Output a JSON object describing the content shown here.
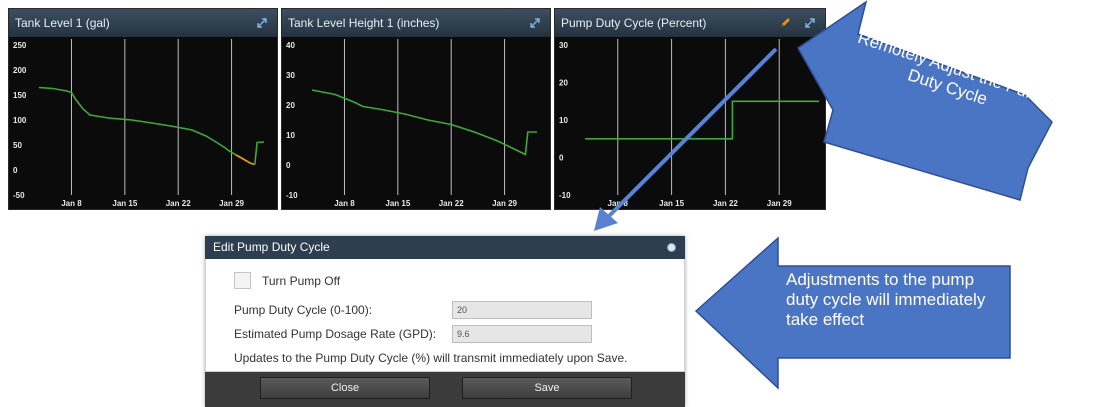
{
  "panels": [
    {
      "title": "Tank Level 1 (gal)",
      "icon": "expand-icon",
      "chart_data": {
        "type": "line",
        "y_ticks": [
          250,
          200,
          150,
          100,
          50,
          0,
          -50
        ],
        "x_ticks": [
          "Jan 8",
          "Jan 15",
          "Jan 22",
          "Jan 29"
        ],
        "ylim": [
          -50,
          250
        ],
        "grid": "vertical",
        "series": [
          {
            "color": "#3fa83a",
            "points": [
              [
                0,
                165
              ],
              [
                0.06,
                163
              ],
              [
                0.12,
                158
              ],
              [
                0.14,
                155
              ],
              [
                0.16,
                140
              ],
              [
                0.19,
                122
              ],
              [
                0.22,
                110
              ],
              [
                0.3,
                104
              ],
              [
                0.4,
                100
              ],
              [
                0.5,
                93
              ],
              [
                0.58,
                87
              ],
              [
                0.66,
                80
              ],
              [
                0.72,
                68
              ],
              [
                0.77,
                54
              ],
              [
                0.8,
                45
              ],
              [
                0.82,
                38
              ],
              [
                0.85,
                30
              ]
            ]
          },
          {
            "color": "#e8a317",
            "points": [
              [
                0.85,
                30
              ],
              [
                0.88,
                22
              ],
              [
                0.91,
                14
              ],
              [
                0.93,
                11
              ]
            ]
          },
          {
            "color": "#3fa83a",
            "points": [
              [
                0.93,
                11
              ],
              [
                0.94,
                55
              ],
              [
                0.97,
                56
              ]
            ]
          }
        ]
      }
    },
    {
      "title": "Tank Level Height 1 (inches)",
      "icon": "expand-icon",
      "chart_data": {
        "type": "line",
        "y_ticks": [
          40,
          30,
          20,
          10,
          0,
          -10
        ],
        "x_ticks": [
          "Jan 8",
          "Jan 15",
          "Jan 22",
          "Jan 29"
        ],
        "ylim": [
          -10,
          40
        ],
        "grid": "vertical",
        "series": [
          {
            "color": "#3fa83a",
            "points": [
              [
                0,
                25
              ],
              [
                0.1,
                23.5
              ],
              [
                0.18,
                21
              ],
              [
                0.22,
                19.5
              ],
              [
                0.3,
                18.5
              ],
              [
                0.4,
                17
              ],
              [
                0.5,
                15
              ],
              [
                0.6,
                13.5
              ],
              [
                0.7,
                11
              ],
              [
                0.8,
                8
              ],
              [
                0.88,
                5
              ],
              [
                0.92,
                3.5
              ],
              [
                0.93,
                11
              ],
              [
                0.97,
                11
              ]
            ]
          }
        ]
      }
    },
    {
      "title": "Pump Duty Cycle (Percent)",
      "icon": "expand-icon",
      "edit_icon": "pencil-icon",
      "chart_data": {
        "type": "line",
        "y_ticks": [
          30,
          20,
          10,
          0,
          -10
        ],
        "x_ticks": [
          "Jan 8",
          "Jan 15",
          "Jan 22",
          "Jan 29"
        ],
        "ylim": [
          -10,
          30
        ],
        "grid": "vertical",
        "series": [
          {
            "color": "#3fa83a",
            "points": [
              [
                0,
                5
              ],
              [
                0.63,
                5
              ],
              [
                0.63,
                15
              ],
              [
                1,
                15
              ]
            ]
          }
        ]
      }
    }
  ],
  "callouts": {
    "top": "Remotely Adjust the Pump Duty Cycle",
    "bottom": "Adjustments to the pump duty cycle will immediately take effect"
  },
  "dialog": {
    "title": "Edit Pump Duty Cycle",
    "close_icon": "close-icon",
    "turn_off_label": "Turn Pump Off",
    "duty_label": "Pump Duty Cycle (0-100):",
    "duty_value": "20",
    "rate_label": "Estimated Pump Dosage Rate (GPD):",
    "rate_value": "9.6",
    "note": "Updates to the Pump Duty Cycle (%) will transmit immediately upon Save.",
    "close_button": "Close",
    "save_button": "Save"
  },
  "colors": {
    "panel_bg": "#0b0b0b",
    "header_bg": "#2f3f4e",
    "series_green": "#3fa83a",
    "series_orange": "#e8a317",
    "callout_blue": "#4a74c4",
    "dialog_header": "#2c3e50",
    "pencil_orange": "#f08a1c"
  }
}
